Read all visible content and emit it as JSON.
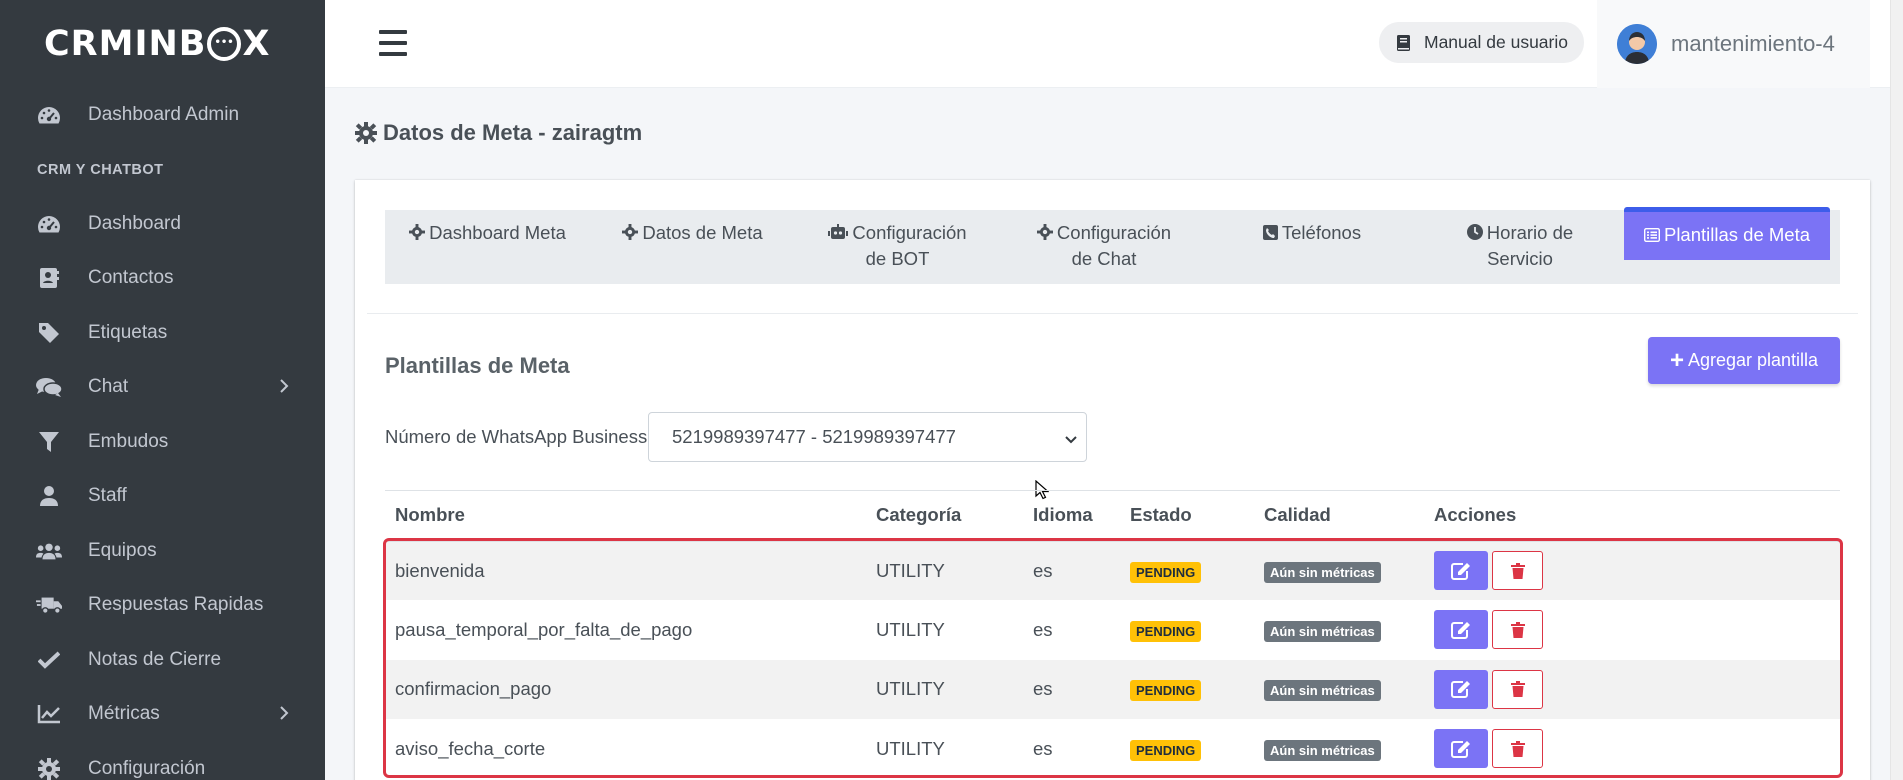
{
  "brand": {
    "logo_left": "CRMINB",
    "logo_right": "X"
  },
  "sidebar": {
    "items": [
      {
        "label": "Dashboard Admin",
        "icon": "tachometer-icon"
      },
      {
        "header": "CRM Y CHATBOT"
      },
      {
        "label": "Dashboard",
        "icon": "tachometer-icon"
      },
      {
        "label": "Contactos",
        "icon": "address-book-icon"
      },
      {
        "label": "Etiquetas",
        "icon": "tag-icon"
      },
      {
        "label": "Chat",
        "icon": "comments-icon",
        "has_children": true
      },
      {
        "label": "Embudos",
        "icon": "filter-icon"
      },
      {
        "label": "Staff",
        "icon": "user-icon"
      },
      {
        "label": "Equipos",
        "icon": "users-icon"
      },
      {
        "label": "Respuestas Rapidas",
        "icon": "truck-fast-icon"
      },
      {
        "label": "Notas de Cierre",
        "icon": "check-icon"
      },
      {
        "label": "Métricas",
        "icon": "chart-line-icon",
        "has_children": true
      },
      {
        "label": "Configuración",
        "icon": "gear-icon"
      }
    ]
  },
  "topbar": {
    "manual_label": "Manual de usuario",
    "user_name": "mantenimiento-4"
  },
  "page": {
    "title": "Datos de Meta - zairagtm"
  },
  "tabs": [
    {
      "label": "Dashboard Meta",
      "icon": "gear-icon",
      "active": false
    },
    {
      "label": "Datos de Meta",
      "icon": "gear-icon",
      "active": false
    },
    {
      "label": "Configuración de BOT",
      "icon": "robot-icon",
      "active": false
    },
    {
      "label": "Configuración de Chat",
      "icon": "gear-icon",
      "active": false
    },
    {
      "label": "Teléfonos",
      "icon": "phone-square-icon",
      "active": false
    },
    {
      "label": "Horario de Servicio",
      "icon": "clock-icon",
      "active": false
    },
    {
      "label": "Plantillas de Meta",
      "icon": "list-alt-icon",
      "active": true
    }
  ],
  "section": {
    "title": "Plantillas de Meta",
    "add_button": "Agregar plantilla",
    "wa_label": "Número de WhatsApp Business",
    "wa_selected": "5219989397477 - 5219989397477"
  },
  "table": {
    "headers": [
      "Nombre",
      "Categoría",
      "Idioma",
      "Estado",
      "Calidad",
      "Acciones"
    ],
    "rows": [
      {
        "name": "bienvenida",
        "category": "UTILITY",
        "language": "es",
        "status": "PENDING",
        "quality": "Aún sin métricas"
      },
      {
        "name": "pausa_temporal_por_falta_de_pago",
        "category": "UTILITY",
        "language": "es",
        "status": "PENDING",
        "quality": "Aún sin métricas"
      },
      {
        "name": "confirmacion_pago",
        "category": "UTILITY",
        "language": "es",
        "status": "PENDING",
        "quality": "Aún sin métricas"
      },
      {
        "name": "aviso_fecha_corte",
        "category": "UTILITY",
        "language": "es",
        "status": "PENDING",
        "quality": "Aún sin métricas"
      }
    ]
  },
  "colors": {
    "sidebar_bg": "#343a40",
    "accent": "#7b73f5",
    "pending": "#ffc107",
    "metric_badge": "#6c757d",
    "danger": "#dc3545"
  }
}
